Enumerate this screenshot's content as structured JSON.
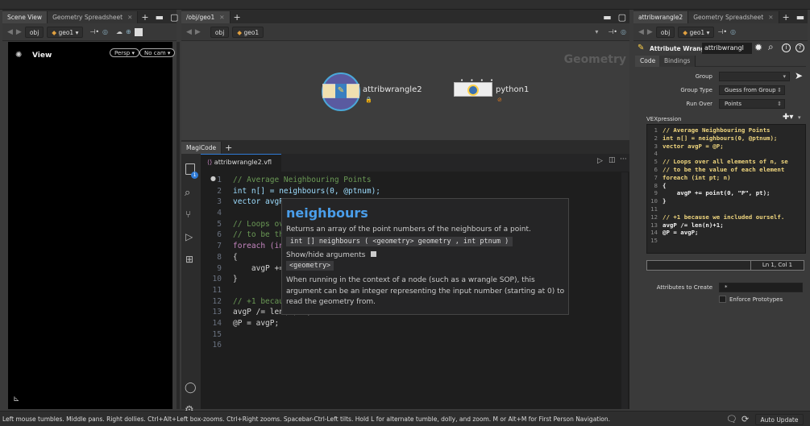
{
  "top_strip": {},
  "left_pane": {
    "tabs": [
      {
        "label": "Scene View"
      },
      {
        "label": "Geometry Spreadsheet"
      }
    ],
    "path": {
      "obj": "obj",
      "geo": "geo1"
    },
    "viewer": {
      "title": "View",
      "persp": "Persp ▾",
      "cam": "No cam ▾"
    }
  },
  "network_pane": {
    "tabs": [
      {
        "label": "/obj/geo1"
      }
    ],
    "path": {
      "obj": "obj",
      "geo": "geo1"
    },
    "context_label": "Geometry",
    "nodes": [
      {
        "name": "attribwrangle2"
      },
      {
        "name": "python1"
      }
    ]
  },
  "magicode_pane": {
    "tab": "MagiCode",
    "file_tab": "attribwrangle2.vfl",
    "activity_badge": "1",
    "code_lines": [
      {
        "n": "1",
        "text": "// Average Neighbouring Points"
      },
      {
        "n": "2",
        "text": "int n[] = neighbours(0, @ptnum);"
      },
      {
        "n": "3",
        "text": "vector avgP = @P;"
      },
      {
        "n": "4",
        "text": ""
      },
      {
        "n": "5",
        "text": "// Loops over all elements of n, setting pt"
      },
      {
        "n": "6",
        "text": "// to be the value of each element"
      },
      {
        "n": "7",
        "text": "foreach (int pt; n)"
      },
      {
        "n": "8",
        "text": "{"
      },
      {
        "n": "9",
        "text": "    avgP += point(0, \"P\", pt);"
      },
      {
        "n": "10",
        "text": "}"
      },
      {
        "n": "11",
        "text": ""
      },
      {
        "n": "12",
        "text": "// +1 because we included ourself."
      },
      {
        "n": "13",
        "text": "avgP /= len(n)+1;"
      },
      {
        "n": "14",
        "text": "@P = avgP;"
      },
      {
        "n": "15",
        "text": ""
      },
      {
        "n": "16",
        "text": ""
      }
    ],
    "hover": {
      "title": "neighbours",
      "desc": "Returns an array of the point numbers of the neighbours of a point.",
      "signature": "int [] neighbours ( <geometry> geometry , int ptnum )",
      "toggle": "Show/hide arguments",
      "arg": "<geometry>",
      "detail": "When running in the context of a node (such as a wrangle SOP), this argument can be an integer representing the input number (starting at 0) to read the geometry from."
    }
  },
  "right_pane": {
    "tabs": [
      {
        "label": "attribwrangle2"
      },
      {
        "label": "Geometry Spreadsheet"
      }
    ],
    "path": {
      "obj": "obj",
      "geo": "geo1"
    },
    "node_type": "Attribute Wrangle",
    "node_name": "attribwrangl",
    "subtabs": [
      {
        "label": "Code"
      },
      {
        "label": "Bindings"
      }
    ],
    "params": {
      "group_label": "Group",
      "group_type_label": "Group Type",
      "group_type_value": "Guess from Group",
      "run_over_label": "Run Over",
      "run_over_value": "Points",
      "vex_label": "VEXpression",
      "status": "Ln 1, Col 1",
      "attrs_label": "Attributes to Create",
      "attrs_value": "*",
      "enforce_label": "Enforce Prototypes"
    },
    "vex_lines": [
      {
        "n": "1",
        "text": "// Average Neighbouring Points"
      },
      {
        "n": "2",
        "text": "int n[] = neighbours(0, @ptnum);"
      },
      {
        "n": "3",
        "text": "vector avgP = @P;"
      },
      {
        "n": "4",
        "text": ""
      },
      {
        "n": "5",
        "text": "// Loops over all elements of n, se"
      },
      {
        "n": "6",
        "text": "// to be the value of each element"
      },
      {
        "n": "7",
        "text": "foreach (int pt; n)"
      },
      {
        "n": "8",
        "text": "{"
      },
      {
        "n": "9",
        "text": "    avgP += point(0, \"P\", pt);"
      },
      {
        "n": "10",
        "text": "}"
      },
      {
        "n": "11",
        "text": ""
      },
      {
        "n": "12",
        "text": "// +1 because we included ourself."
      },
      {
        "n": "13",
        "text": "avgP /= len(n)+1;"
      },
      {
        "n": "14",
        "text": "@P = avgP;"
      },
      {
        "n": "15",
        "text": ""
      }
    ]
  },
  "status_bar": {
    "text": "Left mouse tumbles. Middle pans. Right dollies. Ctrl+Alt+Left box-zooms. Ctrl+Right zooms. Spacebar-Ctrl-Left tilts. Hold L for alternate tumble, dolly, and zoom. M or Alt+M for First Person Navigation.",
    "auto_update": "Auto Update"
  }
}
